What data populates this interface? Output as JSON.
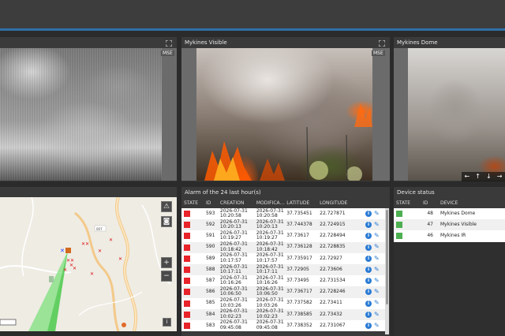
{
  "panels": {
    "cam1": {
      "title": "",
      "tag": "MSE"
    },
    "cam2": {
      "title": "Mykines Visible",
      "tag": "MSE"
    },
    "cam3": {
      "title": "Mykines Dome"
    },
    "alarm": {
      "title": "Alarm of the 24 last hour(s)"
    },
    "device": {
      "title": "Device status"
    }
  },
  "ptz": [
    "←",
    "↑",
    "↓",
    "→"
  ],
  "map": {
    "road_label": "007",
    "buttons": {
      "warning": "⚠",
      "camera": "◙",
      "zoom_in": "+",
      "zoom_out": "−",
      "info": "i"
    }
  },
  "alarm_table": {
    "columns": [
      "STATE",
      "ID",
      "CREATION",
      "MODIFICA...",
      "LATITUDE",
      "LONGITUDE"
    ],
    "state_color": "#e8232a",
    "rows": [
      {
        "id": "593",
        "creation": "2026-07-31 10:20:58",
        "modified": "2026-07-31 10:20:58",
        "lat": "37.735451",
        "lon": "22.727871"
      },
      {
        "id": "592",
        "creation": "2026-07-31 10:20:13",
        "modified": "2026-07-31 10:20:13",
        "lat": "37.744378",
        "lon": "22.724915"
      },
      {
        "id": "591",
        "creation": "2026-07-31 10:19:27",
        "modified": "2026-07-31 10:19:27",
        "lat": "37.73617",
        "lon": "22.728494"
      },
      {
        "id": "590",
        "creation": "2026-07-31 10:18:42",
        "modified": "2026-07-31 10:18:42",
        "lat": "37.736128",
        "lon": "22.728835"
      },
      {
        "id": "589",
        "creation": "2026-07-31 10:17:57",
        "modified": "2026-07-31 10:17:57",
        "lat": "37.735917",
        "lon": "22.72927"
      },
      {
        "id": "588",
        "creation": "2026-07-31 10:17:11",
        "modified": "2026-07-31 10:17:11",
        "lat": "37.72905",
        "lon": "22.73606"
      },
      {
        "id": "587",
        "creation": "2026-07-31 10:16:26",
        "modified": "2026-07-31 10:16:26",
        "lat": "37.73495",
        "lon": "22.731534"
      },
      {
        "id": "586",
        "creation": "2026-07-31 10:06:50",
        "modified": "2026-07-31 10:06:50",
        "lat": "37.736717",
        "lon": "22.728246"
      },
      {
        "id": "585",
        "creation": "2026-07-31 10:03:26",
        "modified": "2026-07-31 10:03:26",
        "lat": "37.737582",
        "lon": "22.73411"
      },
      {
        "id": "584",
        "creation": "2026-07-31 10:02:23",
        "modified": "2026-07-31 10:02:23",
        "lat": "37.738585",
        "lon": "22.73432"
      },
      {
        "id": "583",
        "creation": "2026-07-31 09:45:08",
        "modified": "2026-07-31 09:45:08",
        "lat": "37.738352",
        "lon": "22.731067"
      }
    ]
  },
  "device_table": {
    "columns": [
      "STATE",
      "ID",
      "DEVICE"
    ],
    "state_color": "#4caf50",
    "rows": [
      {
        "id": "48",
        "device": "Mykines Dome"
      },
      {
        "id": "47",
        "device": "Mykines Visible"
      },
      {
        "id": "46",
        "device": "Mykines IR"
      }
    ]
  }
}
